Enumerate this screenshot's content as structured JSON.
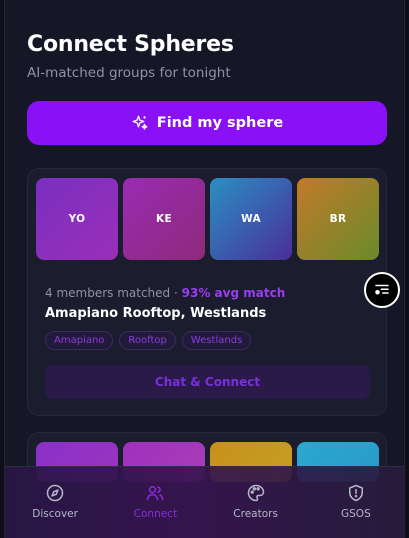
{
  "header": {
    "title": "Connect Spheres",
    "subtitle": "AI-matched groups for tonight"
  },
  "cta": {
    "label": "Find my sphere",
    "icon": "sparkles-icon"
  },
  "sphere": {
    "members": [
      "YO",
      "KE",
      "WA",
      "BR"
    ],
    "members_matched": "4 members matched",
    "separator": "·",
    "avg_match": "93% avg match",
    "name": "Amapiano Rooftop, Westlands",
    "tags": [
      "Amapiano",
      "Rooftop",
      "Westlands"
    ],
    "action_label": "Chat & Connect"
  },
  "fab": {
    "icon": "filter-list-icon"
  },
  "nav": {
    "items": [
      {
        "label": "Discover",
        "icon": "compass-icon"
      },
      {
        "label": "Connect",
        "icon": "users-icon"
      },
      {
        "label": "Creators",
        "icon": "palette-icon"
      },
      {
        "label": "GSOS",
        "icon": "shield-alert-icon"
      }
    ],
    "active": "Connect"
  },
  "colors": {
    "accent": "#8a10f5",
    "background": "#161726",
    "card": "#1b1c2d"
  }
}
